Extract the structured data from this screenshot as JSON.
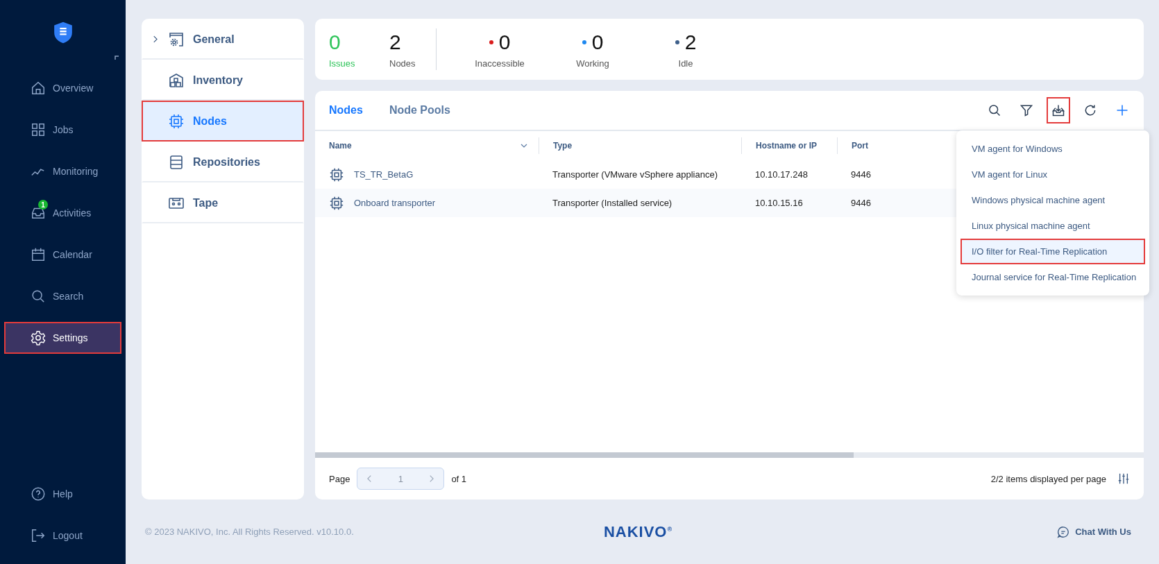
{
  "sidebar": {
    "items": [
      {
        "label": "Overview",
        "kind": "home",
        "selected": false,
        "highlighted": false
      },
      {
        "label": "Jobs",
        "kind": "grid",
        "selected": false,
        "highlighted": false
      },
      {
        "label": "Monitoring",
        "kind": "chart",
        "selected": false,
        "highlighted": false
      },
      {
        "label": "Activities",
        "kind": "inbox",
        "badge": "1",
        "selected": false,
        "highlighted": false
      },
      {
        "label": "Calendar",
        "kind": "calendar",
        "selected": false,
        "highlighted": false
      },
      {
        "label": "Search",
        "kind": "search",
        "selected": false,
        "highlighted": false
      },
      {
        "label": "Settings",
        "kind": "gear",
        "selected": true,
        "highlighted": true
      }
    ],
    "bottom": [
      {
        "label": "Help",
        "kind": "help"
      },
      {
        "label": "Logout",
        "kind": "logout"
      }
    ]
  },
  "settings_menu": [
    {
      "label": "General",
      "kind": "general",
      "expandable": true,
      "selected": false,
      "highlighted": false
    },
    {
      "label": "Inventory",
      "kind": "inventory",
      "expandable": false,
      "selected": false,
      "highlighted": false
    },
    {
      "label": "Nodes",
      "kind": "chip",
      "expandable": false,
      "selected": true,
      "highlighted": true
    },
    {
      "label": "Repositories",
      "kind": "repo",
      "expandable": false,
      "selected": false,
      "highlighted": false
    },
    {
      "label": "Tape",
      "kind": "tape",
      "expandable": false,
      "selected": false,
      "highlighted": false
    }
  ],
  "summary": {
    "totals": [
      {
        "value": "0",
        "label": "Issues",
        "kind": "issues"
      },
      {
        "value": "2",
        "label": "Nodes",
        "kind": "plain"
      }
    ],
    "states": [
      {
        "value": "0",
        "label": "Inaccessible",
        "color": "#d91c1c"
      },
      {
        "value": "0",
        "label": "Working",
        "color": "#1e88f0"
      },
      {
        "value": "2",
        "label": "Idle",
        "color": "#3e5f8a"
      }
    ]
  },
  "tabs": [
    {
      "label": "Nodes",
      "selected": true
    },
    {
      "label": "Node Pools",
      "selected": false
    }
  ],
  "toolbar": [
    {
      "kind": "search",
      "highlighted": false
    },
    {
      "kind": "filter",
      "highlighted": false
    },
    {
      "kind": "download",
      "highlighted": true
    },
    {
      "kind": "refresh",
      "highlighted": false
    },
    {
      "kind": "plus",
      "highlighted": false
    }
  ],
  "table": {
    "columns": [
      "Name",
      "Type",
      "Hostname or IP",
      "Port"
    ],
    "rows": [
      {
        "name": "TS_TR_BetaG",
        "type": "Transporter (VMware vSphere appliance)",
        "host": "10.10.17.248",
        "port": "9446"
      },
      {
        "name": "Onboard transporter",
        "type": "Transporter (Installed service)",
        "host": "10.10.15.16",
        "port": "9446"
      }
    ]
  },
  "download_menu": [
    {
      "label": "VM agent for Windows",
      "hovered": false,
      "highlighted": false
    },
    {
      "label": "VM agent for Linux",
      "hovered": false,
      "highlighted": false
    },
    {
      "label": "Windows physical machine agent",
      "hovered": false,
      "highlighted": false
    },
    {
      "label": "Linux physical machine agent",
      "hovered": false,
      "highlighted": false
    },
    {
      "label": "I/O filter for Real-Time Replication",
      "hovered": true,
      "highlighted": true
    },
    {
      "label": "Journal service for Real-Time Replication",
      "hovered": false,
      "highlighted": false
    }
  ],
  "pagination": {
    "label": "Page",
    "page": "1",
    "of": "of 1",
    "per_page": "2/2 items displayed per page"
  },
  "footer": {
    "copyright": "© 2023 NAKIVO, Inc. All Rights Reserved. v10.10.0.",
    "logo": "NAKIVO",
    "logo_mark": "®",
    "chat": "Chat With Us"
  }
}
